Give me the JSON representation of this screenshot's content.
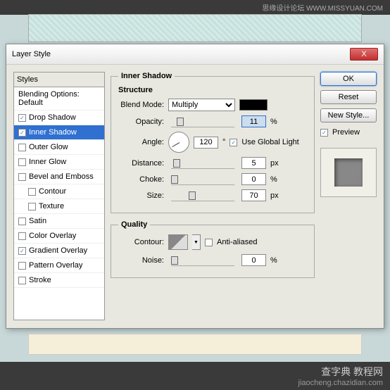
{
  "banner": "思缘设计论坛  WWW.MISSYUAN.COM",
  "dialog_title": "Layer Style",
  "close_x": "X",
  "styles_header": "Styles",
  "blending_header": "Blending Options: Default",
  "style_items": [
    {
      "label": "Drop Shadow",
      "checked": true,
      "selected": false,
      "indent": false
    },
    {
      "label": "Inner Shadow",
      "checked": true,
      "selected": true,
      "indent": false
    },
    {
      "label": "Outer Glow",
      "checked": false,
      "selected": false,
      "indent": false
    },
    {
      "label": "Inner Glow",
      "checked": false,
      "selected": false,
      "indent": false
    },
    {
      "label": "Bevel and Emboss",
      "checked": false,
      "selected": false,
      "indent": false
    },
    {
      "label": "Contour",
      "checked": false,
      "selected": false,
      "indent": true
    },
    {
      "label": "Texture",
      "checked": false,
      "selected": false,
      "indent": true
    },
    {
      "label": "Satin",
      "checked": false,
      "selected": false,
      "indent": false
    },
    {
      "label": "Color Overlay",
      "checked": false,
      "selected": false,
      "indent": false
    },
    {
      "label": "Gradient Overlay",
      "checked": true,
      "selected": false,
      "indent": false
    },
    {
      "label": "Pattern Overlay",
      "checked": false,
      "selected": false,
      "indent": false
    },
    {
      "label": "Stroke",
      "checked": false,
      "selected": false,
      "indent": false
    }
  ],
  "panel_title": "Inner Shadow",
  "structure_title": "Structure",
  "quality_title": "Quality",
  "labels": {
    "blend_mode": "Blend Mode:",
    "opacity": "Opacity:",
    "angle": "Angle:",
    "use_global": "Use Global Light",
    "distance": "Distance:",
    "choke": "Choke:",
    "size": "Size:",
    "contour": "Contour:",
    "antialiased": "Anti-aliased",
    "noise": "Noise:"
  },
  "values": {
    "blend_mode": "Multiply",
    "opacity": "11",
    "angle": "120",
    "angle_unit": "°",
    "distance": "5",
    "choke": "0",
    "size": "70",
    "noise": "0",
    "percent": "%",
    "px": "px"
  },
  "buttons": {
    "ok": "OK",
    "reset": "Reset",
    "new_style": "New Style...",
    "preview": "Preview"
  },
  "footer_big": "查字典 教程网",
  "footer_small": "jiaocheng.chazidian.com"
}
